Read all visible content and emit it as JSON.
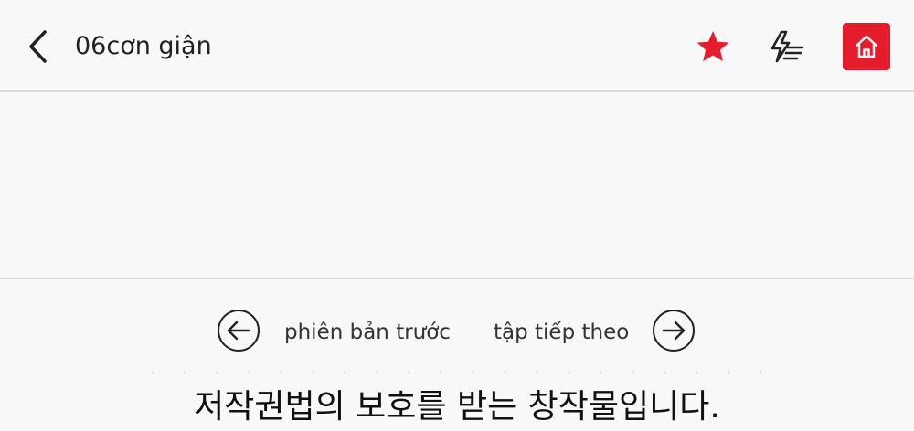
{
  "header": {
    "title": "06cơn giận",
    "icons": {
      "back": "chevron-left-icon",
      "favorite": "star-icon",
      "quick": "flash-list-icon",
      "home": "home-icon"
    },
    "colors": {
      "accent": "#e51c2c",
      "text": "#222222",
      "divider": "#d9d9d9",
      "background": "#f8f8f8"
    }
  },
  "nav": {
    "prev_label": "phiên bản trước",
    "next_label": "tập tiếp theo",
    "prev_icon": "arrow-left-circle-icon",
    "next_icon": "arrow-right-circle-icon"
  },
  "footer": {
    "copyright_text": "저작권법의 보호를 받는 창작물입니다."
  }
}
